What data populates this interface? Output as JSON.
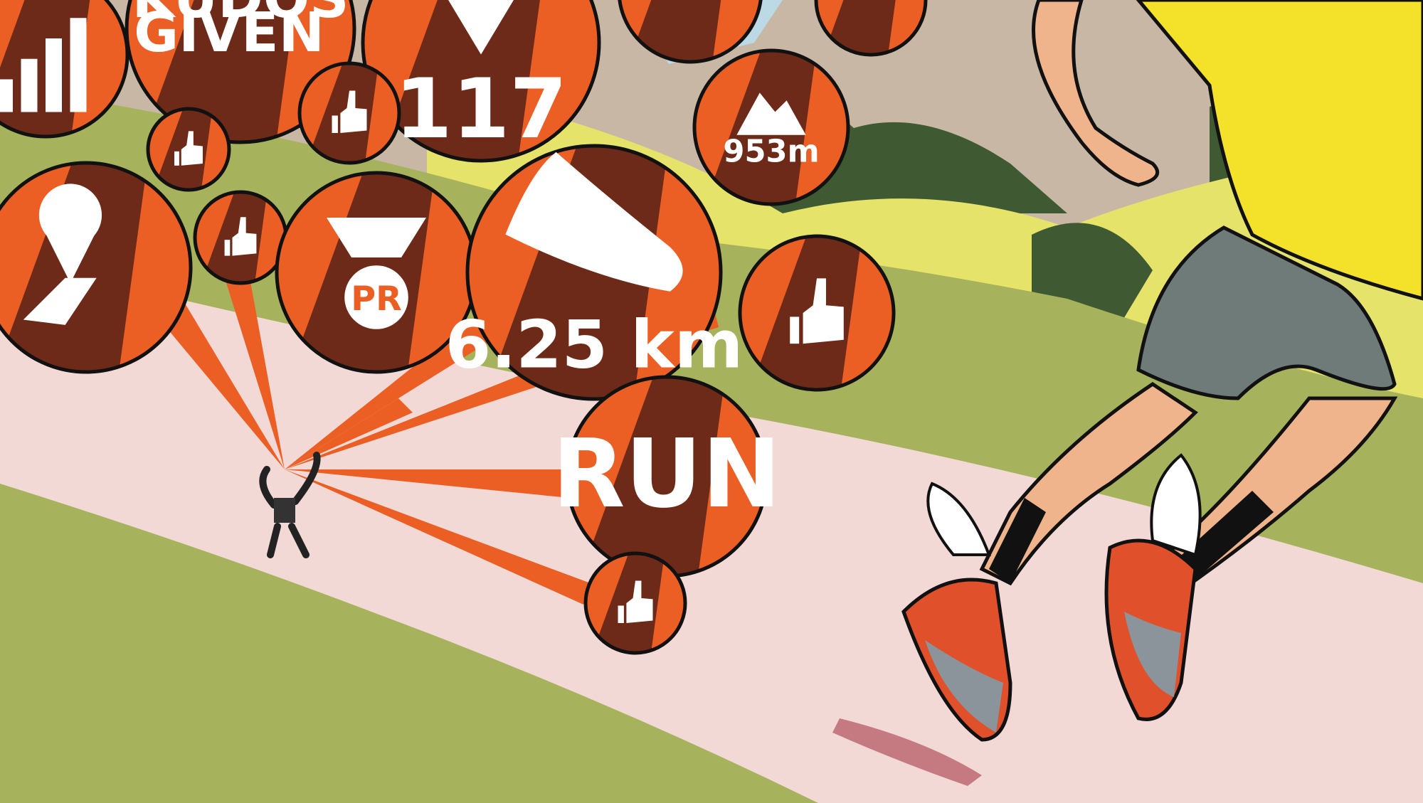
{
  "badges": {
    "kudos_top": "KUDOS",
    "kudos_bottom": "GIVEN",
    "heart_count": "117",
    "elevation": "953m",
    "pr": "PR",
    "distance": "6.25 km",
    "run": "RUN"
  },
  "colors": {
    "badge_orange": "#ec5f24",
    "badge_brown": "#6e2a18",
    "grass": "#a6b25c",
    "path": "#f3d9d6",
    "shirt": "#f4e12a",
    "shorts": "#6f7b78"
  }
}
